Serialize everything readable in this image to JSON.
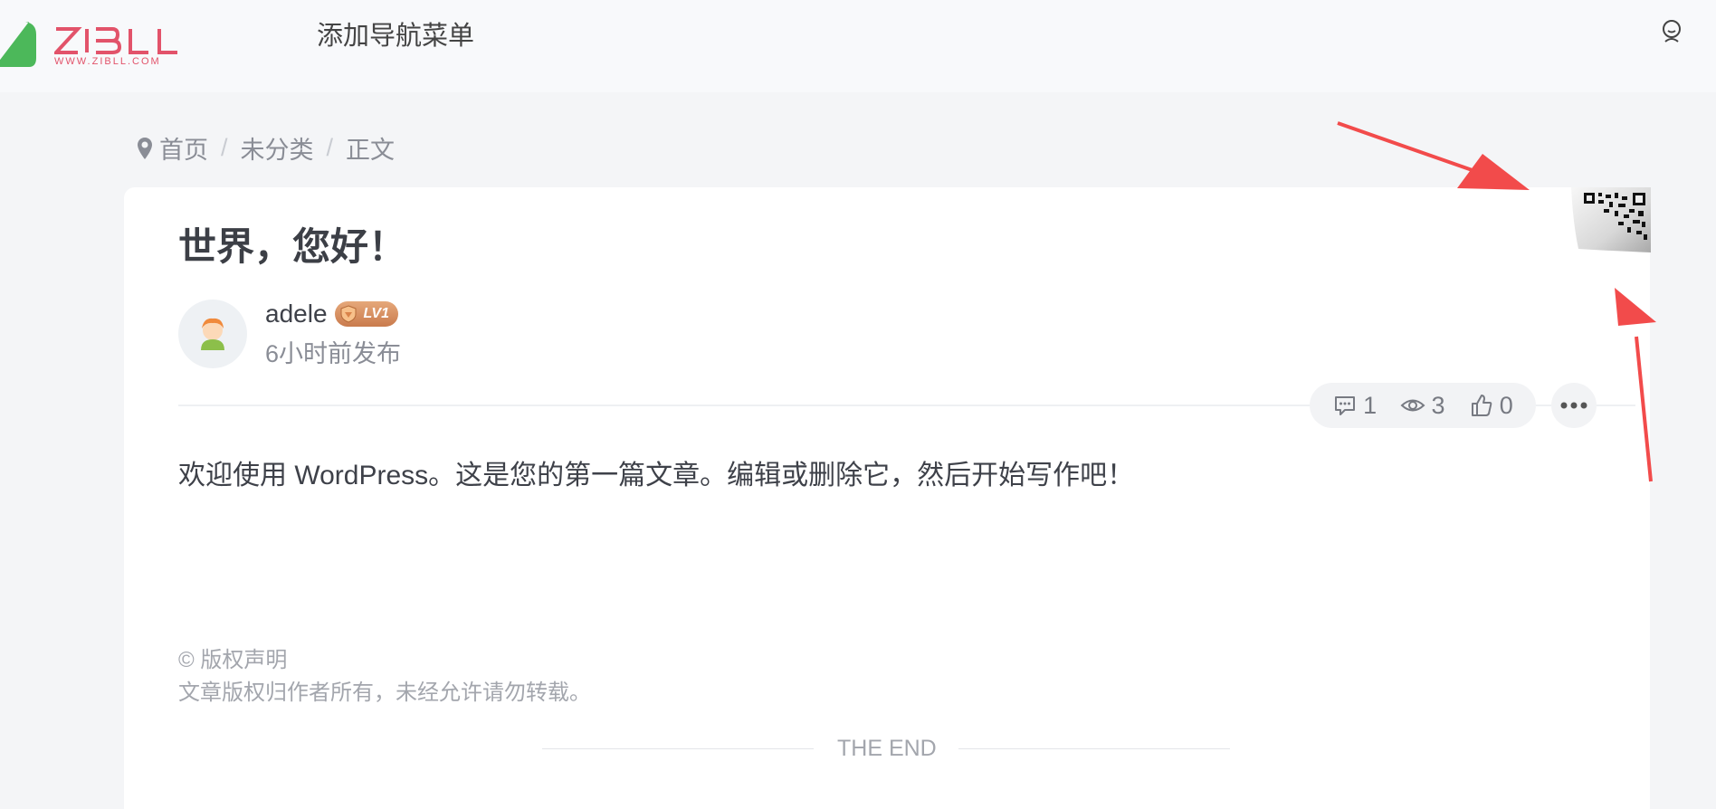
{
  "header": {
    "logo_text": "ZIBLL",
    "logo_subtext": "WWW.ZIBLL.COM",
    "nav_item": "添加导航菜单"
  },
  "breadcrumb": {
    "items": [
      "首页",
      "未分类",
      "正文"
    ],
    "separator": "/"
  },
  "post": {
    "title": "世界，您好！",
    "author": "adele",
    "level": "LV1",
    "time": "6小时前发布",
    "stats": {
      "comments": "1",
      "views": "3",
      "likes": "0"
    },
    "content": "欢迎使用 WordPress。这是您的第一篇文章。编辑或删除它，然后开始写作吧！",
    "copyright_title": "© 版权声明",
    "copyright_text": "文章版权归作者所有，未经允许请勿转载。",
    "end_text": "THE END"
  },
  "colors": {
    "brand_pink": "#e2536a",
    "brand_green": "#4cb85a",
    "annotation_arrow": "#f24b4b"
  },
  "icons": [
    "map-pin-icon",
    "user-icon",
    "comment-icon",
    "eye-icon",
    "thumbs-up-icon",
    "more-icon",
    "qr-code-icon"
  ]
}
